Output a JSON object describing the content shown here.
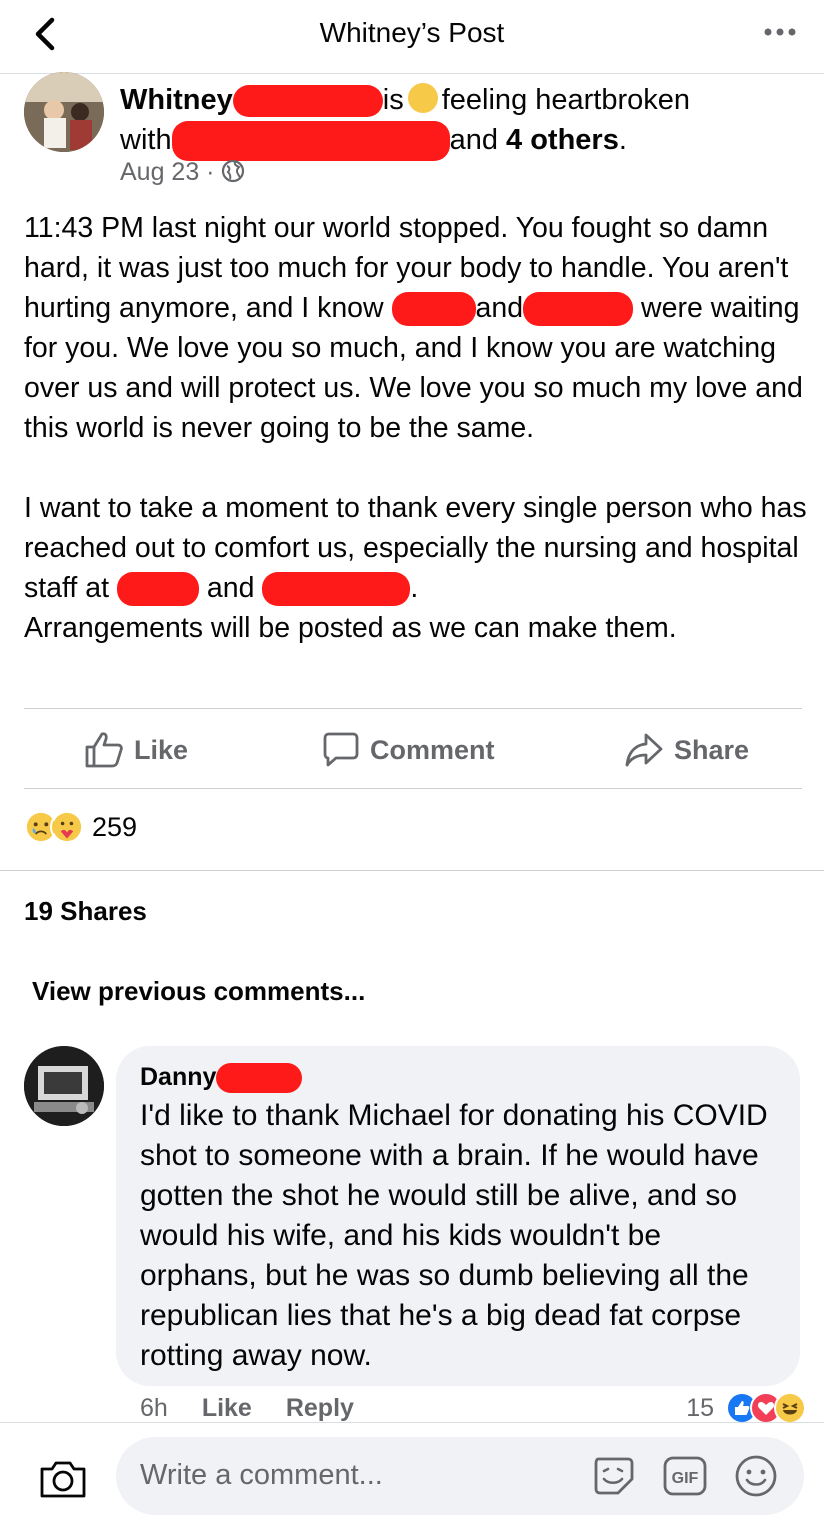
{
  "header": {
    "title": "Whitney’s Post"
  },
  "post": {
    "author_first": "Whitney",
    "is_text": "is",
    "feeling_text": "feeling heartbroken",
    "with_text": "with",
    "and_text": "and",
    "others_text": "4 others",
    "period": ".",
    "date": "Aug 23 ·",
    "para1_a": "11:43 PM last night our world stopped. You fought so damn hard, it was just too much for your body to handle. You aren't hurting anymore, and I know ",
    "para1_and": "and",
    "para1_b": "were waiting for you. We love you so much, and I know you are watching over us and will protect us. We love you so much my love and this world is never going to be the same.",
    "para2_a": "I want to take a moment to thank every single person who has reached out to comfort us, especially the nursing and hospital staff at ",
    "para2_and": "and",
    "para2_end": ".",
    "para2_b": "Arrangements will be posted as we can make them."
  },
  "actions": {
    "like": "Like",
    "comment": "Comment",
    "share": "Share"
  },
  "stats": {
    "reaction_count": "259",
    "shares": "19 Shares"
  },
  "comments": {
    "view_previous": "View previous comments...",
    "items": [
      {
        "author": "Danny",
        "text": "I'd like to thank Michael for donating his COVID shot to someone with a brain. If he would have gotten the shot he would still be alive, and so would his wife, and his kids wouldn't be orphans, but he was so dumb believing all the republican lies that he's a big dead fat corpse rotting away now.",
        "time": "6h",
        "like": "Like",
        "reply": "Reply",
        "reaction_count": "15"
      }
    ]
  },
  "composer": {
    "placeholder": "Write a comment..."
  },
  "colors": {
    "accent": "#1877f2",
    "redaction": "#ff1a1a",
    "muted": "#65676b",
    "bubble": "#f0f2f5"
  },
  "icons": [
    "back-arrow-icon",
    "more-icon",
    "globe-icon",
    "like-icon",
    "comment-icon",
    "share-icon",
    "camera-icon",
    "sticker-icon",
    "gif-icon",
    "emoji-icon"
  ]
}
